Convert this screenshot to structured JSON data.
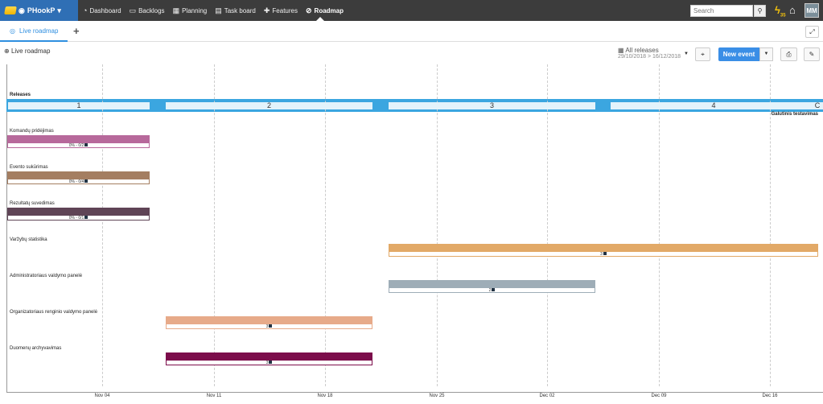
{
  "app": {
    "name": "PHookP"
  },
  "nav": {
    "items": [
      "Dashboard",
      "Backlogs",
      "Planning",
      "Task board",
      "Features",
      "Roadmap"
    ],
    "active": "Roadmap"
  },
  "search": {
    "placeholder": "Search"
  },
  "notifications": {
    "count": "35"
  },
  "user": {
    "initials": "MM"
  },
  "tabs": [
    {
      "label": "Live roadmap"
    }
  ],
  "page": {
    "title": "Live roadmap"
  },
  "release_filter": {
    "label": "All releases",
    "dates": "29/10/2018 > 16/12/2018"
  },
  "toolbar": {
    "new_event": "New event"
  },
  "colors": {
    "brand": "#2f6fb5",
    "accent": "#3a8ee6",
    "releases": "#3ba6e0"
  },
  "chart_data": {
    "type": "gantt",
    "x_ticks": [
      "Nov 04",
      "Nov 11",
      "Nov 18",
      "Nov 25",
      "Dec 02",
      "Dec 09",
      "Dec 16"
    ],
    "releases_label": "Releases",
    "releases": [
      "1",
      "2",
      "3",
      "4",
      "C"
    ],
    "milestone": "Galutinis testavimas",
    "rows": [
      {
        "name": "Komandų pridėjimas",
        "progress": "0% - 0/2",
        "color": "#b7699b"
      },
      {
        "name": "Evento sukūrimas",
        "progress": "0% - 0/4",
        "color": "#a47e61"
      },
      {
        "name": "Rezultatų suvedimas",
        "progress": "0% - 0/1",
        "color": "#5f4456"
      },
      {
        "name": "Varžybų statistika",
        "progress": "3",
        "color": "#e2a967"
      },
      {
        "name": "Administratoriaus valdymo panelė",
        "progress": "2",
        "color": "#9eadb7"
      },
      {
        "name": "Organizatoriaus renginio valdymo panelė",
        "progress": "3",
        "color": "#e7aa89"
      },
      {
        "name": "Duomenų archyvavimas",
        "progress": "3",
        "color": "#7c0d4b"
      }
    ]
  }
}
